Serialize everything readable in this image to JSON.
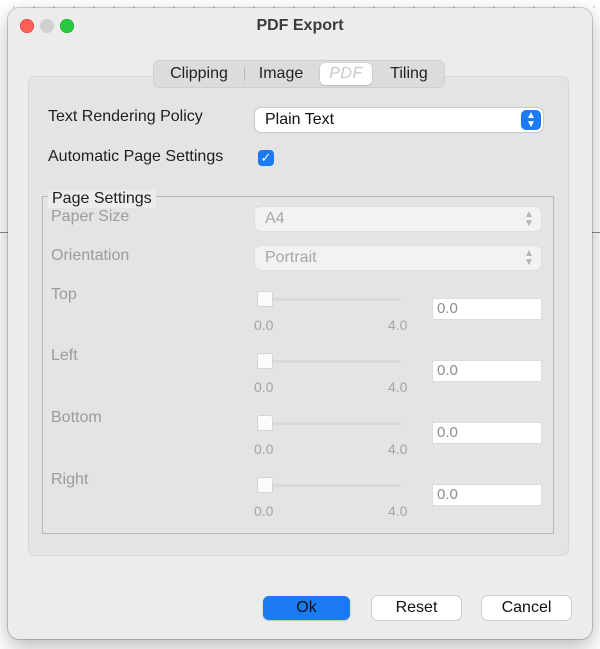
{
  "window": {
    "title": "PDF Export"
  },
  "tabs": [
    {
      "label": "Clipping",
      "selected": false
    },
    {
      "label": "Image",
      "selected": false
    },
    {
      "label": "PDF",
      "selected": true
    },
    {
      "label": "Tiling",
      "selected": false
    }
  ],
  "text_rendering": {
    "label": "Text Rendering Policy",
    "value": "Plain Text",
    "icon": "chevron-updown-icon"
  },
  "auto_page": {
    "label": "Automatic Page Settings",
    "checked": true
  },
  "page_settings": {
    "title": "Page Settings",
    "paper_size": {
      "label": "Paper Size",
      "value": "A4"
    },
    "orientation": {
      "label": "Orientation",
      "value": "Portrait"
    },
    "margins": [
      {
        "label": "Top",
        "min": "0.0",
        "max": "4.0",
        "value": "0.0"
      },
      {
        "label": "Left",
        "min": "0.0",
        "max": "4.0",
        "value": "0.0"
      },
      {
        "label": "Bottom",
        "min": "0.0",
        "max": "4.0",
        "value": "0.0"
      },
      {
        "label": "Right",
        "min": "0.0",
        "max": "4.0",
        "value": "0.0"
      }
    ]
  },
  "buttons": {
    "ok": "Ok",
    "reset": "Reset",
    "cancel": "Cancel"
  },
  "colors": {
    "accent": "#1a7bf2",
    "close": "#fe5f57",
    "maximize": "#28c840"
  }
}
